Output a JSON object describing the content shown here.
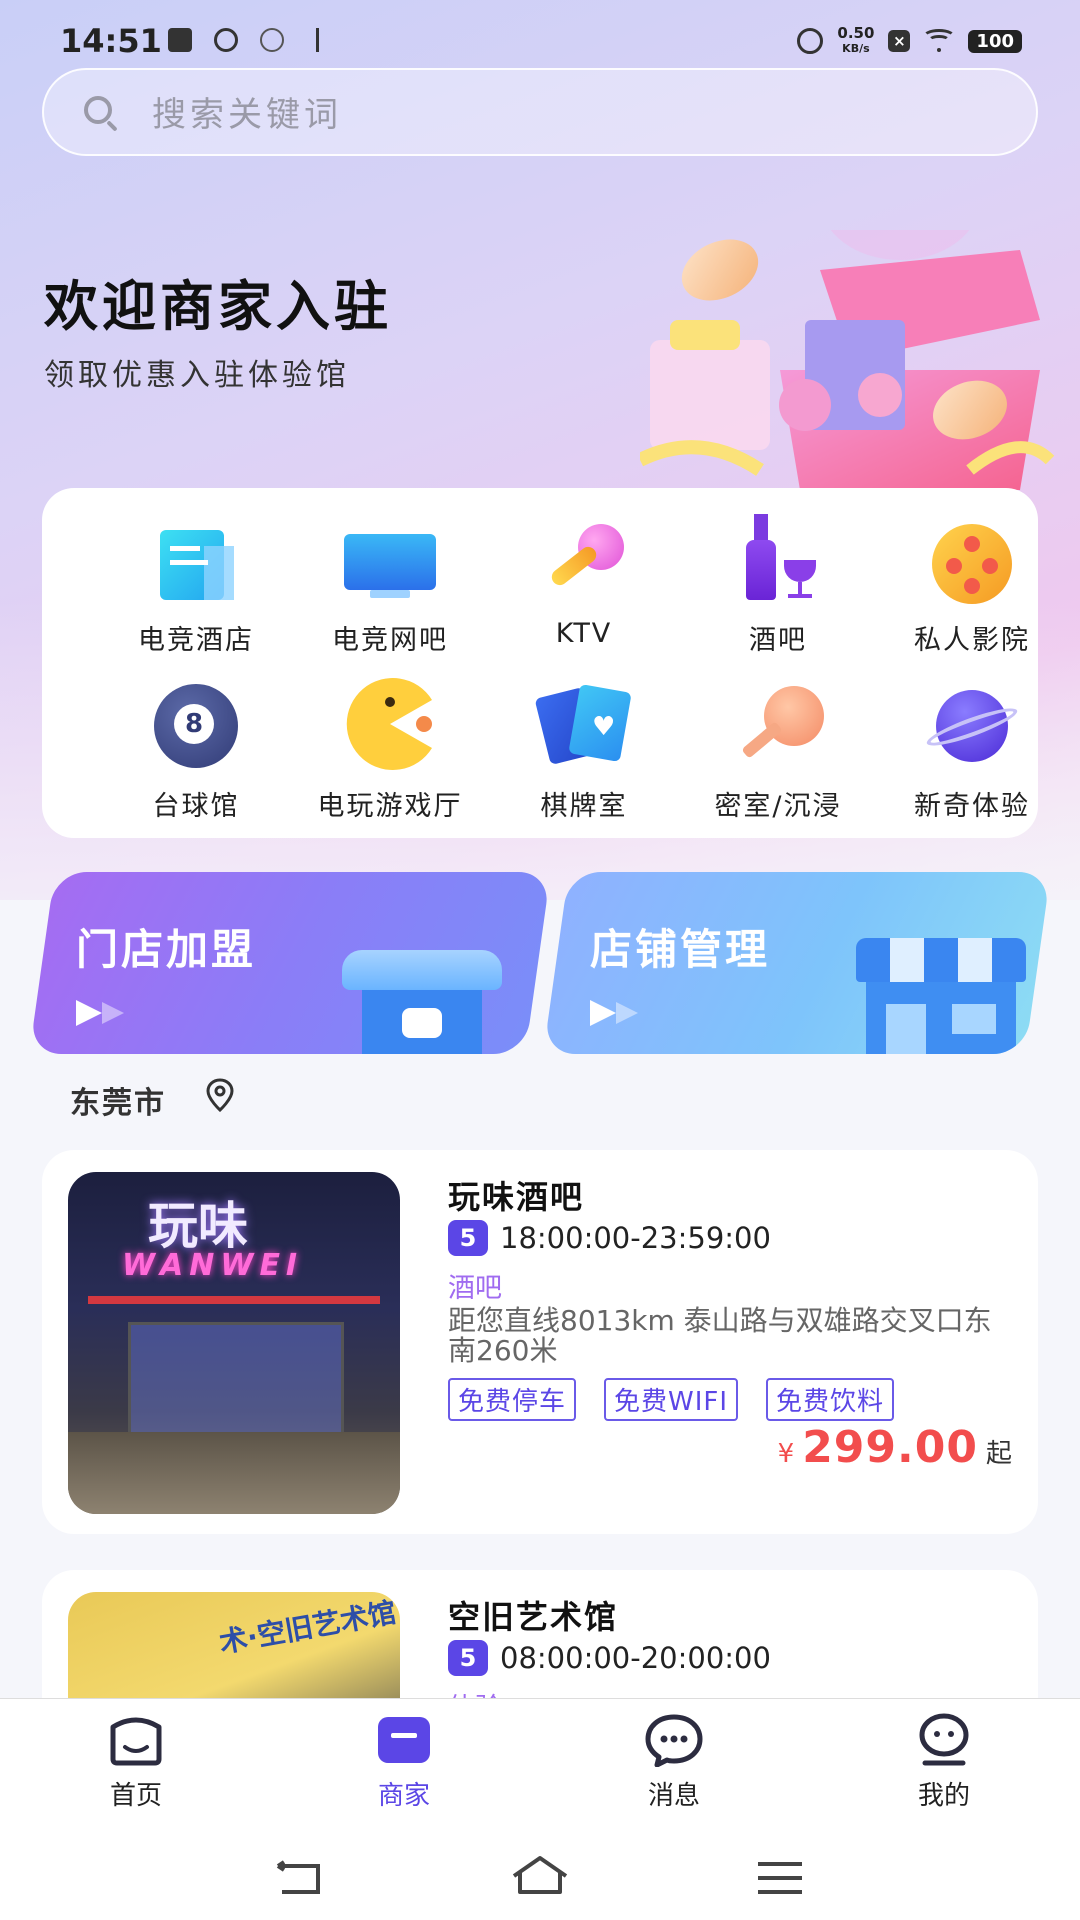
{
  "status_bar": {
    "time": "14:51",
    "net_speed_top": "0.50",
    "net_speed_bottom": "KB/s",
    "battery": "100"
  },
  "search": {
    "placeholder": "搜索关键词"
  },
  "banner": {
    "title": "欢迎商家入驻",
    "subtitle": "领取优惠入驻体验馆"
  },
  "categories": [
    {
      "label": "电竞酒店",
      "icon": "hotel-icon"
    },
    {
      "label": "电竞网吧",
      "icon": "monitor-icon"
    },
    {
      "label": "KTV",
      "icon": "microphone-icon"
    },
    {
      "label": "酒吧",
      "icon": "wine-icon"
    },
    {
      "label": "私人影院",
      "icon": "film-reel-icon"
    },
    {
      "label": "台球馆",
      "icon": "billiard-ball-icon"
    },
    {
      "label": "电玩游戏厅",
      "icon": "pacman-icon"
    },
    {
      "label": "棋牌室",
      "icon": "playing-cards-icon"
    },
    {
      "label": "密室/沉浸",
      "icon": "key-icon"
    },
    {
      "label": "新奇体验",
      "icon": "planet-icon"
    }
  ],
  "promos": [
    {
      "label": "门店加盟",
      "color": "#a56cf2"
    },
    {
      "label": "店铺管理",
      "color": "#8fb1ff"
    }
  ],
  "location": {
    "city": "东莞市"
  },
  "stores": [
    {
      "name": "玩味酒吧",
      "level": "5",
      "hours": "18:00:00-23:59:00",
      "type": "酒吧",
      "address": "距您直线8013km 泰山路与双雄路交叉口东南260米",
      "tags": [
        "免费停车",
        "免费WIFI",
        "免费饮料"
      ],
      "price_currency": "¥",
      "price": "299.00",
      "price_suffix": "起",
      "sign_cn": "玩味",
      "sign_en": "WANWEI"
    },
    {
      "name": "空旧艺术馆",
      "level": "5",
      "hours": "08:00:00-20:00:00",
      "type": "体验",
      "sign_cn": "术·空旧艺术馆"
    }
  ],
  "tabbar": [
    {
      "label": "首页",
      "icon": "home-icon",
      "active": false
    },
    {
      "label": "商家",
      "icon": "shop-icon",
      "active": true
    },
    {
      "label": "消息",
      "icon": "message-icon",
      "active": false
    },
    {
      "label": "我的",
      "icon": "profile-icon",
      "active": false
    }
  ],
  "colors": {
    "accent": "#5b46e6",
    "price": "#f24d4d",
    "type_text": "#a06cf0"
  }
}
